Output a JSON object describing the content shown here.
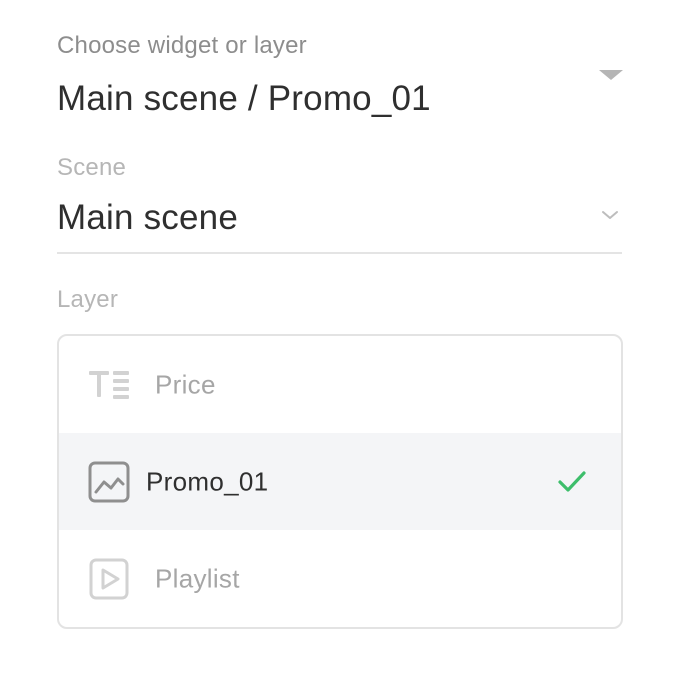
{
  "widget_picker": {
    "caption": "Choose widget or layer",
    "value": "Main scene / Promo_01"
  },
  "scene": {
    "caption": "Scene",
    "value": "Main scene"
  },
  "layer": {
    "caption": "Layer",
    "items": [
      {
        "label": "Price",
        "icon": "text-icon",
        "selected": false
      },
      {
        "label": "Promo_01",
        "icon": "image-icon",
        "selected": true
      },
      {
        "label": "Playlist",
        "icon": "playlist-icon",
        "selected": false
      }
    ]
  },
  "colors": {
    "check": "#3dbe6b",
    "selected_bg": "#f4f5f7",
    "border": "#e3e3e3"
  }
}
